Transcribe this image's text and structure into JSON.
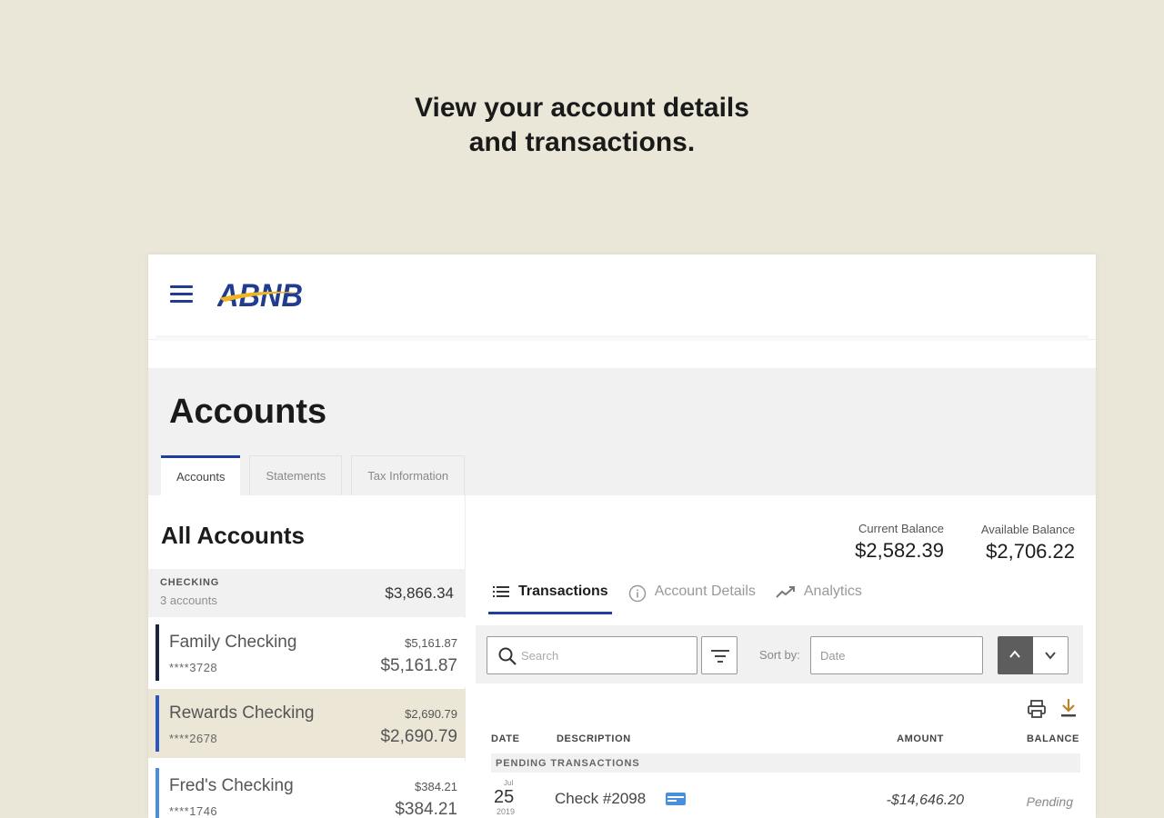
{
  "headline": {
    "line1": "View your account details",
    "line2": "and transactions."
  },
  "brand": {
    "name": "ABNB",
    "primary_color": "#1f3c8f",
    "accent_color": "#f2b320"
  },
  "page": {
    "title": "Accounts"
  },
  "tabs": [
    {
      "label": "Accounts",
      "active": true
    },
    {
      "label": "Statements",
      "active": false
    },
    {
      "label": "Tax Information",
      "active": false
    }
  ],
  "sidebar": {
    "title": "All Accounts",
    "group": {
      "label": "CHECKING",
      "count": "3 accounts",
      "total": "$3,866.34"
    },
    "accounts": [
      {
        "name": "Family Checking",
        "mask": "****3728",
        "balance_small": "$5,161.87",
        "balance": "$5,161.87",
        "bar_color": "#1c2340",
        "selected": false
      },
      {
        "name": "Rewards Checking",
        "mask": "****2678",
        "balance_small": "$2,690.79",
        "balance": "$2,690.79",
        "bar_color": "#2a56c6",
        "selected": true
      },
      {
        "name": "Fred's Checking",
        "mask": "****1746",
        "balance_small": "$384.21",
        "balance": "$384.21",
        "bar_color": "#4a8ee0",
        "selected": false
      }
    ]
  },
  "balances": {
    "current": {
      "label": "Current Balance",
      "value": "$2,582.39"
    },
    "available": {
      "label": "Available Balance",
      "value": "$2,706.22"
    }
  },
  "sub_tabs": [
    {
      "label": "Transactions",
      "icon": "list-icon",
      "active": true
    },
    {
      "label": "Account Details",
      "icon": "info-icon",
      "active": false
    },
    {
      "label": "Analytics",
      "icon": "trend-icon",
      "active": false
    }
  ],
  "filters": {
    "search_placeholder": "Search",
    "sort_label": "Sort by:",
    "sort_value": "Date"
  },
  "table": {
    "headers": {
      "date": "DATE",
      "description": "DESCRIPTION",
      "amount": "AMOUNT",
      "balance": "BALANCE"
    },
    "pending_label": "PENDING TRANSACTIONS",
    "rows": [
      {
        "month": "Jul",
        "day": "25",
        "year": "2019",
        "description": "Check #2098",
        "amount": "-$14,646.20",
        "status": "Pending"
      }
    ]
  }
}
